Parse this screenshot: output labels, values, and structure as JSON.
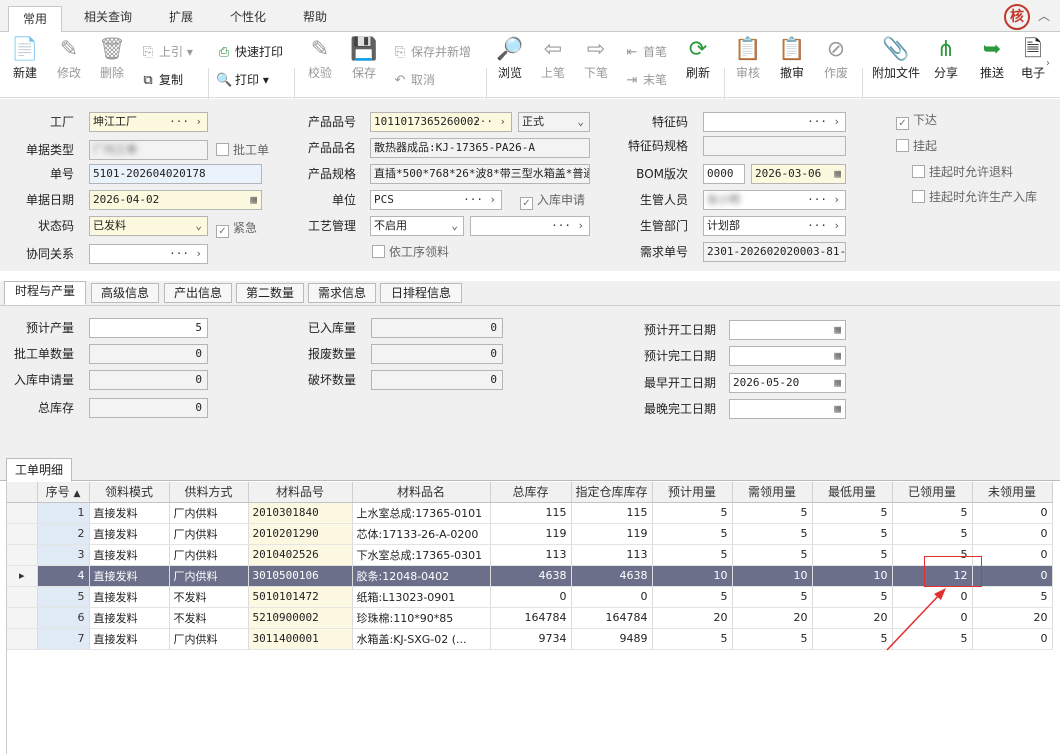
{
  "tabs": [
    "常用",
    "相关查询",
    "扩展",
    "个性化",
    "帮助"
  ],
  "logo_char": "核",
  "toolbar": {
    "new": "新建",
    "edit": "修改",
    "delete": "删除",
    "prev_up": "上引",
    "copy": "复制",
    "quick_print": "快速打印",
    "print": "打印",
    "verify": "校验",
    "save": "保存",
    "save_new": "保存并新增",
    "cancel": "取消",
    "browse": "浏览",
    "prev": "上笔",
    "next": "下笔",
    "first": "首笔",
    "last": "末笔",
    "refresh": "刷新",
    "audit": "审核",
    "unaudit": "撤审",
    "void": "作废",
    "attach": "附加文件",
    "share": "分享",
    "push": "推送",
    "electronic": "电子"
  },
  "header_form": {
    "factory_label": "工厂",
    "factory": "坤江工厂",
    "doctype_label": "单据类型",
    "doctype": "厂内工单",
    "batch_label": "批工单",
    "docno_label": "单号",
    "docno": "5101-202604020178",
    "docdate_label": "单据日期",
    "docdate": "2026-04-02",
    "status_label": "状态码",
    "status": "已发料",
    "urgent_label": "紧急",
    "coop_label": "协同关系",
    "coop": "",
    "product_no_label": "产品品号",
    "product_no": "1011017365260002",
    "product_type": "正式",
    "product_name_label": "产品品名",
    "product_name": "散热器成品:KJ-17365-PA26-A",
    "product_spec_label": "产品规格",
    "product_spec": "直插*500*768*26*波8*带三型水箱盖*普通",
    "unit_label": "单位",
    "unit": "PCS",
    "instock_label": "入库申请",
    "process_label": "工艺管理",
    "process": "不启用",
    "process2": "",
    "by_process_label": "依工序领料",
    "feature_label": "特征码",
    "feature": "",
    "feature_spec_label": "特征码规格",
    "feature_spec": "",
    "bom_label": "BOM版次",
    "bom_ver": "0000",
    "bom_date": "2026-03-06",
    "manager_label": "生管人员",
    "manager": "张小明",
    "dept_label": "生管部门",
    "dept": "计划部",
    "demand_label": "需求单号",
    "demand": "2301-202602020003-81-1",
    "issued_label": "下达",
    "suspend_label": "挂起",
    "allow_return_label": "挂起时允许退料",
    "allow_instock_label": "挂起时允许生产入库"
  },
  "subtabs": [
    "时程与产量",
    "高级信息",
    "产出信息",
    "第二数量",
    "需求信息",
    "日排程信息"
  ],
  "qty_form": {
    "plan_qty_label": "预计产量",
    "plan_qty": "5",
    "batch_qty_label": "批工单数量",
    "batch_qty": "0",
    "instock_qty_label": "入库申请量",
    "instock_qty": "0",
    "total_stock_label": "总库存",
    "total_stock": "0",
    "stocked_label": "已入库量",
    "stocked": "0",
    "scrap_label": "报废数量",
    "scrap": "0",
    "damage_label": "破坏数量",
    "damage": "0",
    "plan_start_label": "预计开工日期",
    "plan_start": "",
    "plan_end_label": "预计完工日期",
    "plan_end": "",
    "early_start_label": "最早开工日期",
    "early_start": "2026-05-20",
    "late_end_label": "最晚完工日期",
    "late_end": ""
  },
  "grid_tab": "工单明细",
  "grid": {
    "columns": [
      "序号",
      "领料模式",
      "供料方式",
      "材料品号",
      "材料品名",
      "总库存",
      "指定仓库库存",
      "预计用量",
      "需领用量",
      "最低用量",
      "已领用量",
      "未领用量"
    ],
    "rows": [
      [
        "1",
        "直接发料",
        "厂内供料",
        "2010301840",
        "上水室总成:17365-0101",
        "115",
        "115",
        "5",
        "5",
        "5",
        "5",
        "0"
      ],
      [
        "2",
        "直接发料",
        "厂内供料",
        "2010201290",
        "芯体:17133-26-A-0200",
        "119",
        "119",
        "5",
        "5",
        "5",
        "5",
        "0"
      ],
      [
        "3",
        "直接发料",
        "厂内供料",
        "2010402526",
        "下水室总成:17365-0301",
        "113",
        "113",
        "5",
        "5",
        "5",
        "5",
        "0"
      ],
      [
        "4",
        "直接发料",
        "厂内供料",
        "3010500106",
        "胶条:12048-0402",
        "4638",
        "4638",
        "10",
        "10",
        "10",
        "12",
        "0"
      ],
      [
        "5",
        "直接发料",
        "不发料",
        "5010101472",
        "纸箱:L13023-0901",
        "0",
        "0",
        "5",
        "5",
        "5",
        "0",
        "5"
      ],
      [
        "6",
        "直接发料",
        "不发料",
        "5210900002",
        "珍珠棉:110*90*85",
        "164784",
        "164784",
        "20",
        "20",
        "20",
        "0",
        "20"
      ],
      [
        "7",
        "直接发料",
        "厂内供料",
        "3011400001",
        "水箱盖:KJ-SXG-02 (...",
        "9734",
        "9489",
        "5",
        "5",
        "5",
        "5",
        "0"
      ]
    ]
  }
}
